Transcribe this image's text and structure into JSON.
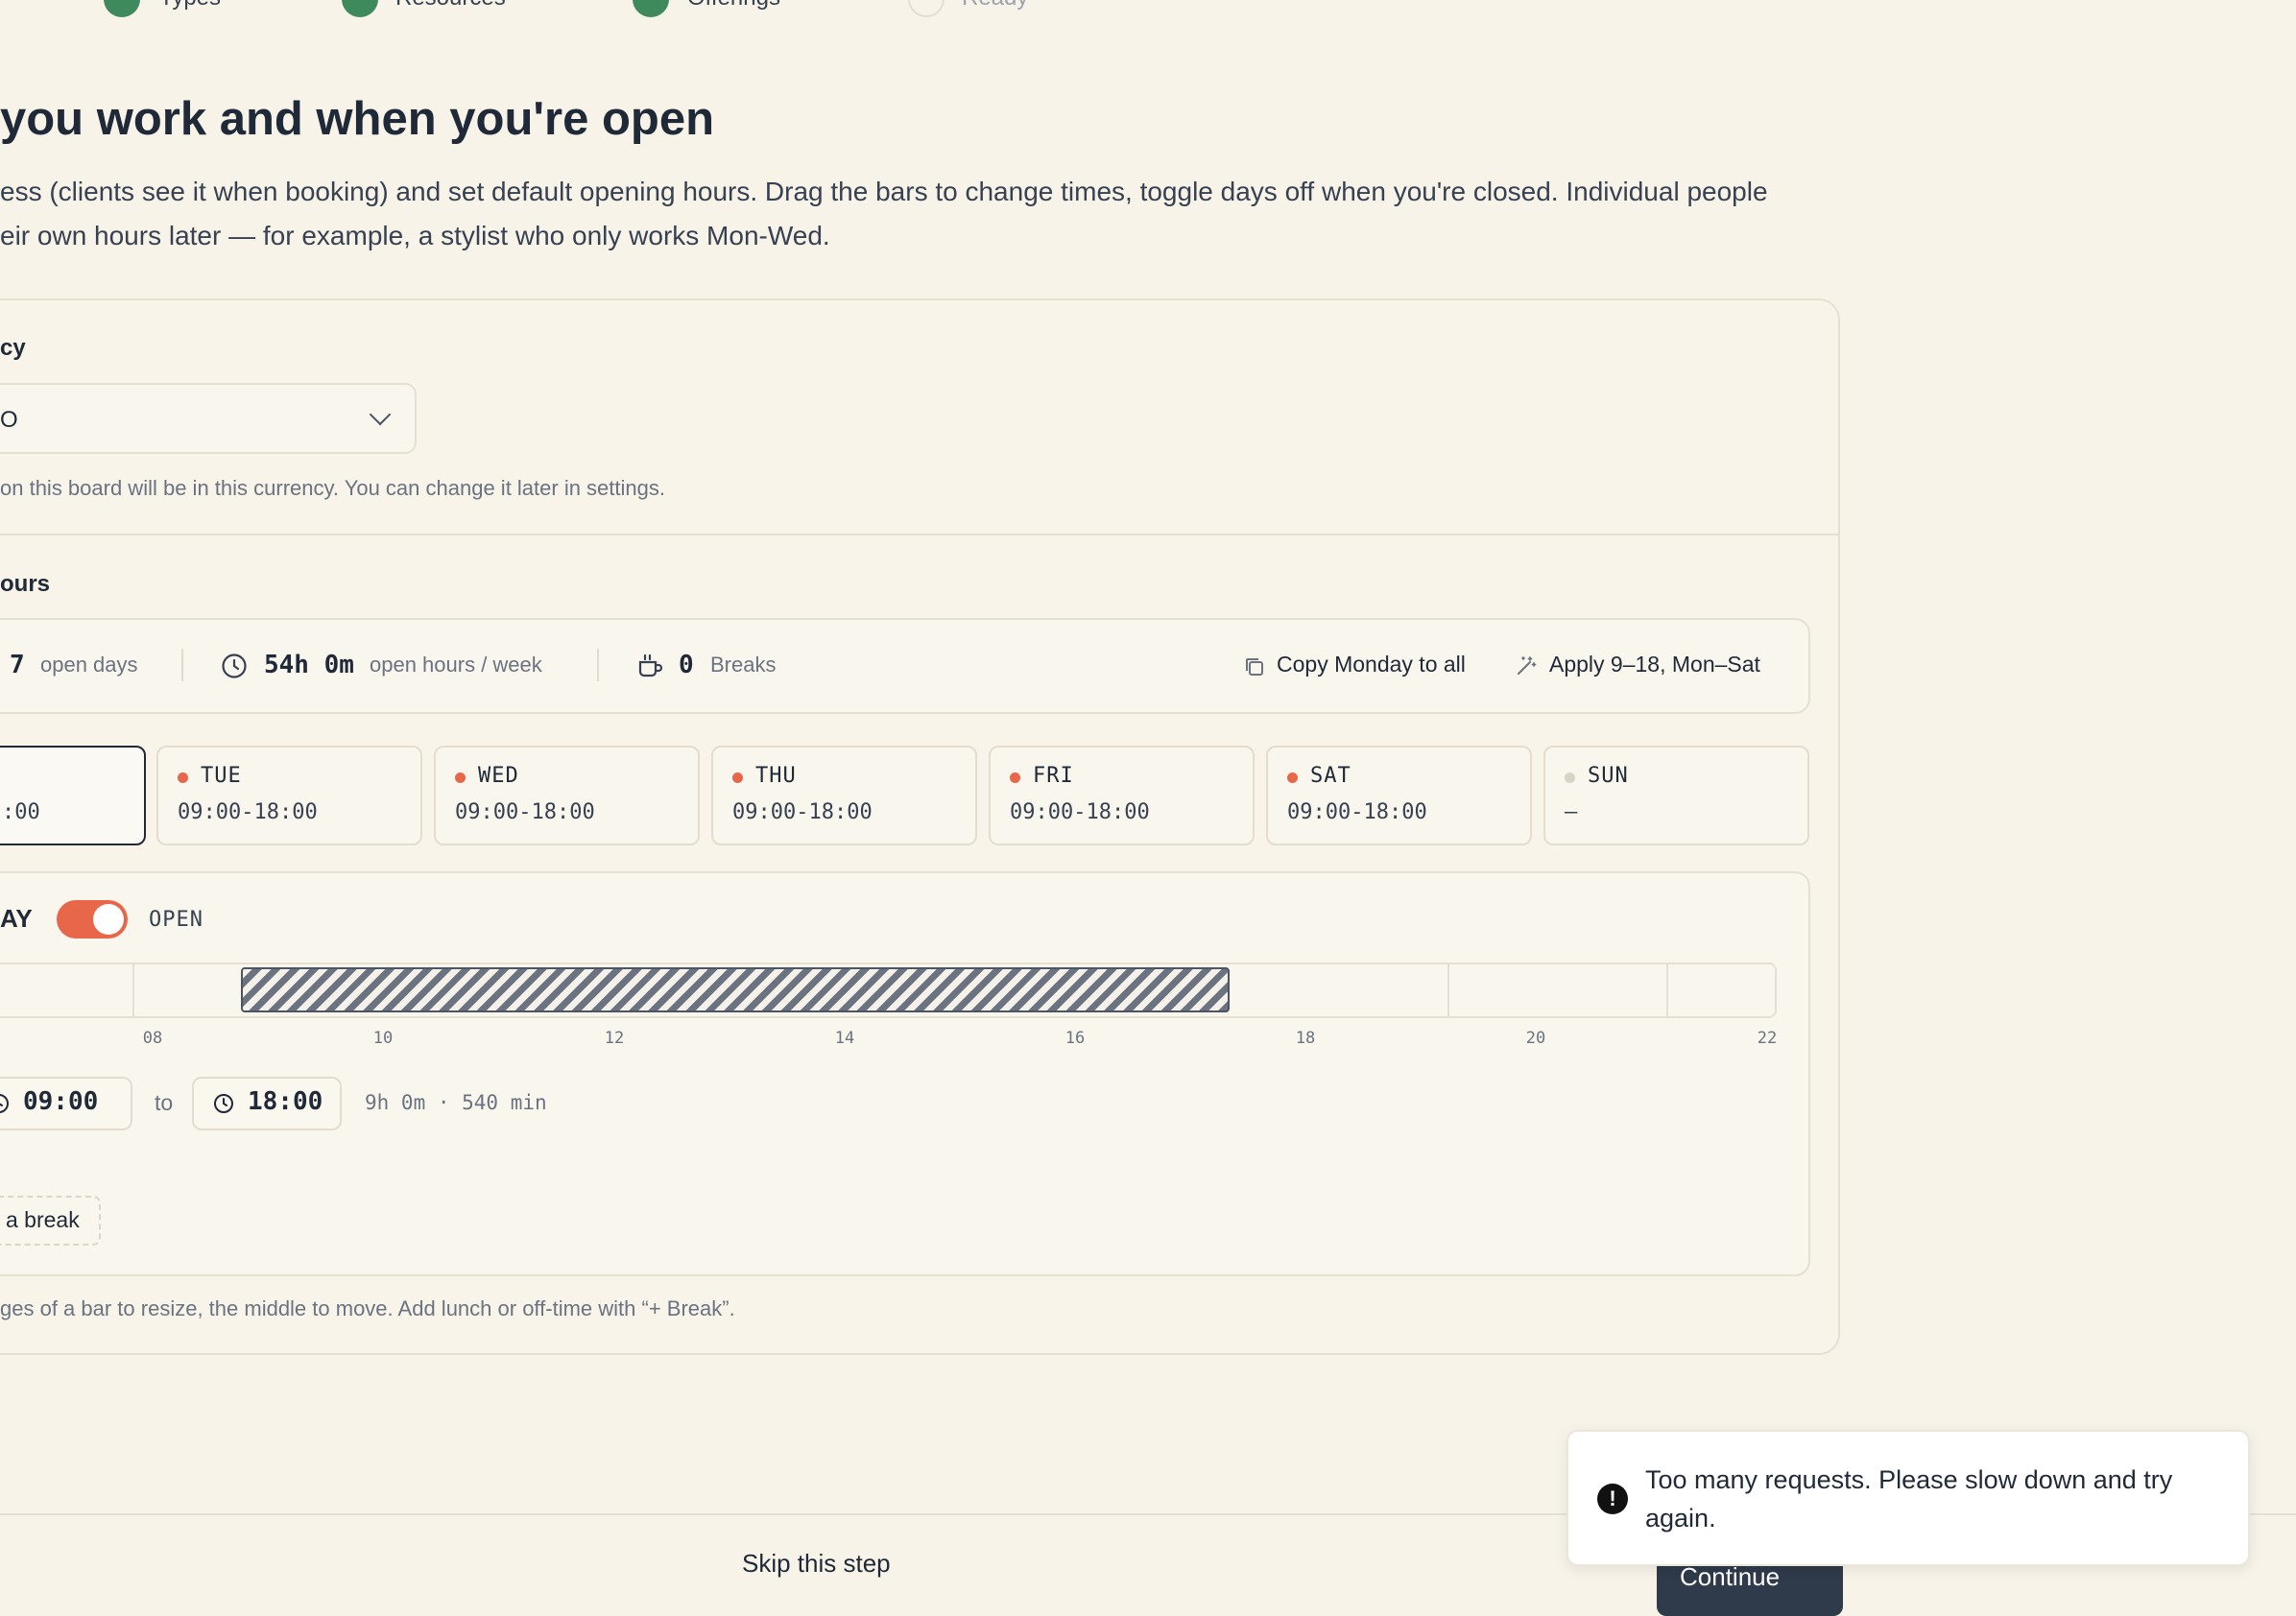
{
  "stepper": {
    "steps": [
      {
        "label": "Types",
        "state": "done"
      },
      {
        "label": "Resources",
        "state": "done"
      },
      {
        "label": "Offerings",
        "state": "done"
      },
      {
        "label": "Ready",
        "state": "pending"
      }
    ]
  },
  "page": {
    "title": "you work and when you're open",
    "intro_line1": "ess (clients see it when booking) and set default opening hours. Drag the bars to change times, toggle days off when you're closed. Individual people",
    "intro_line2": "eir own hours later — for example, a stylist who only works Mon-Wed."
  },
  "currency": {
    "label": "cy",
    "value": "O",
    "helper": "on this board will be in this currency. You can change it later in settings."
  },
  "hours": {
    "label": "ours",
    "stats": {
      "open_days_value": "7",
      "open_days_label": "open days",
      "hours_value": "54h 0m",
      "hours_label": "open hours / week",
      "breaks_value": "0",
      "breaks_label": "Breaks"
    },
    "actions": {
      "copy_monday": "Copy Monday to all",
      "apply_preset": "Apply 9–18, Mon–Sat"
    },
    "days": [
      {
        "name": "",
        "hours": ":00",
        "open": true,
        "active": true
      },
      {
        "name": "TUE",
        "hours": "09:00-18:00",
        "open": true
      },
      {
        "name": "WED",
        "hours": "09:00-18:00",
        "open": true
      },
      {
        "name": "THU",
        "hours": "09:00-18:00",
        "open": true
      },
      {
        "name": "FRI",
        "hours": "09:00-18:00",
        "open": true
      },
      {
        "name": "SAT",
        "hours": "09:00-18:00",
        "open": true
      },
      {
        "name": "SUN",
        "hours": "–",
        "open": false
      }
    ],
    "editor": {
      "day_label": "AY",
      "status_label": "OPEN",
      "is_open": true,
      "timeline_ticks": [
        "08",
        "10",
        "12",
        "14",
        "16",
        "18",
        "20",
        "22"
      ],
      "from_time": "09:00",
      "to_label": "to",
      "to_time": "18:00",
      "duration": "9h 0m · 540 min",
      "add_break": "a break"
    },
    "helper": "ges of a bar to resize, the middle to move. Add lunch or off-time with “+ Break”."
  },
  "footer": {
    "skip": "Skip this step",
    "continue": "Continue"
  },
  "toast": {
    "icon": "alert-icon",
    "message": "Too many requests. Please slow down and try again."
  },
  "colors": {
    "background": "#f7f3e9",
    "accent": "#e8664a",
    "success": "#3f8a5c",
    "primary_button": "#2f3a4a"
  }
}
